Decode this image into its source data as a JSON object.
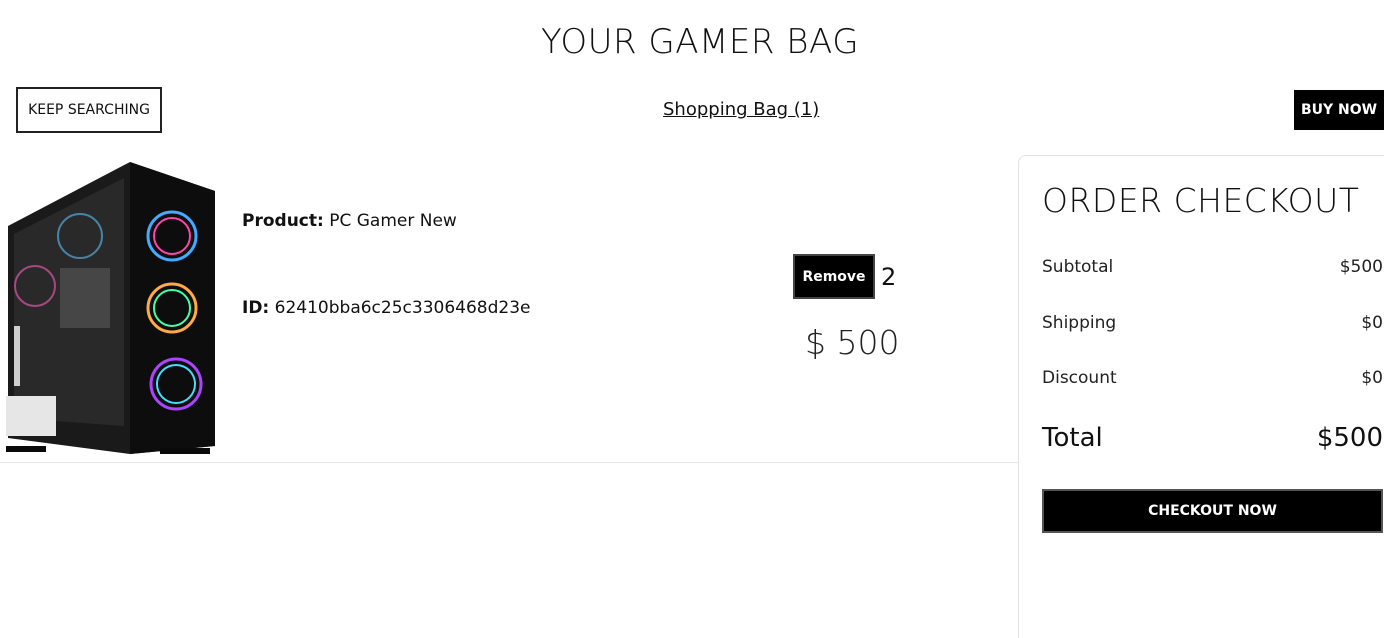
{
  "page": {
    "title": "YOUR GAMER BAG"
  },
  "toolbar": {
    "keep_searching_label": "KEEP SEARCHING",
    "bag_link_label": "Shopping Bag (1)",
    "buy_now_label": "BUY NOW"
  },
  "cart": {
    "items": [
      {
        "product_label": "Product:",
        "product_name": "PC Gamer New",
        "id_label": "ID:",
        "id_value": "62410bba6c25c3306468d23e",
        "remove_label": "Remove",
        "quantity": "2",
        "price": "$ 500",
        "image_icon": "pc-tower-image"
      }
    ]
  },
  "summary": {
    "title": "ORDER CHECKOUT",
    "rows": [
      {
        "label": "Subtotal",
        "value": "$500"
      },
      {
        "label": "Shipping",
        "value": "$0"
      },
      {
        "label": "Discount",
        "value": "$0"
      }
    ],
    "total_label": "Total",
    "total_value": "$500",
    "checkout_label": "CHECKOUT NOW"
  },
  "colors": {
    "primary_button": "#000000",
    "text": "#111111",
    "border": "#e3e3e3"
  }
}
